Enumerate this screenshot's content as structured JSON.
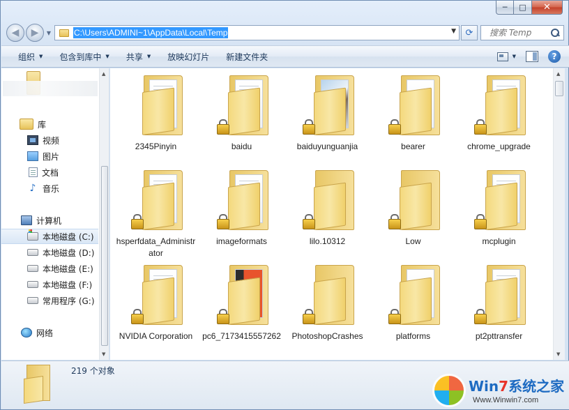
{
  "window": {
    "caption_min": "─",
    "caption_max": "□",
    "caption_close": "✕"
  },
  "nav": {
    "back_glyph": "◀",
    "forward_glyph": "▶",
    "history_glyph": "▼"
  },
  "address": {
    "path": "C:\\Users\\ADMINI~1\\AppData\\Local\\Temp",
    "dropdown_glyph": "▼",
    "refresh_glyph": "⟳"
  },
  "search": {
    "placeholder": "搜索 Temp"
  },
  "toolbar": {
    "organize": "组织",
    "include_in_library": "包含到库中",
    "share": "共享",
    "slideshow": "放映幻灯片",
    "new_folder": "新建文件夹",
    "help_glyph": "?"
  },
  "sidebar": {
    "libraries": "库",
    "videos": "视频",
    "pictures": "图片",
    "documents": "文档",
    "music": "音乐",
    "computer": "计算机",
    "drives": [
      {
        "label": "本地磁盘 (C:)"
      },
      {
        "label": "本地磁盘 (D:)"
      },
      {
        "label": "本地磁盘 (E:)"
      },
      {
        "label": "本地磁盘 (F:)"
      },
      {
        "label": "常用程序 (G:)"
      }
    ],
    "network": "网络",
    "music_glyph": "♪"
  },
  "files": [
    {
      "name": "2345Pinyin",
      "locked": false,
      "paper": "lines"
    },
    {
      "name": "baidu",
      "locked": true,
      "paper": "lines"
    },
    {
      "name": "baiduyunguanjia",
      "locked": true,
      "paper": "photo"
    },
    {
      "name": "bearer",
      "locked": true,
      "paper": "gear"
    },
    {
      "name": "chrome_upgrade",
      "locked": true,
      "paper": "lines"
    },
    {
      "name": "hsperfdata_Administrator",
      "locked": true,
      "paper": "lines"
    },
    {
      "name": "imageformats",
      "locked": true,
      "paper": "lines"
    },
    {
      "name": "lilo.10312",
      "locked": true,
      "paper": "none"
    },
    {
      "name": "Low",
      "locked": true,
      "paper": "none"
    },
    {
      "name": "mcplugin",
      "locked": true,
      "paper": "lines"
    },
    {
      "name": "NVIDIA Corporation",
      "locked": true,
      "paper": "lines"
    },
    {
      "name": "pc6_7173415557262",
      "locked": true,
      "paper": "orange"
    },
    {
      "name": "PhotoshopCrashes",
      "locked": true,
      "paper": "none"
    },
    {
      "name": "platforms",
      "locked": true,
      "paper": "gear"
    },
    {
      "name": "pt2pttransfer",
      "locked": true,
      "paper": "lines"
    }
  ],
  "status": {
    "count": "219 个对象"
  },
  "watermark": {
    "title_prefix": "Win",
    "title_seven": "7",
    "title_suffix": "系统之家",
    "url": "Www.Winwin7.com"
  },
  "colors": {
    "selection": "#3399ff",
    "folder": "#f4d97e",
    "window_frame": "#d5e3f3"
  }
}
